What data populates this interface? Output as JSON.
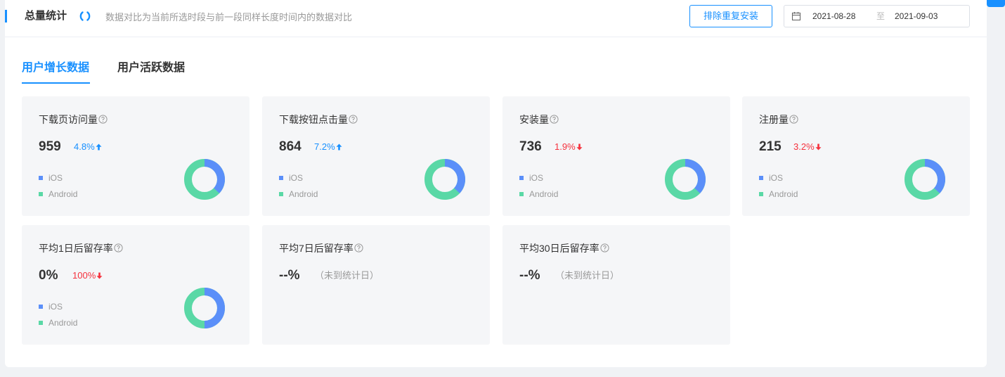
{
  "header": {
    "title": "总量统计",
    "subtitle": "数据对比为当前所选时段与前一段同样长度时间内的数据对比",
    "dedupe_button": "排除重复安装",
    "date_start": "2021-08-28",
    "date_separator": "至",
    "date_end": "2021-09-03"
  },
  "tabs": [
    {
      "label": "用户增长数据",
      "active": true
    },
    {
      "label": "用户活跃数据",
      "active": false
    }
  ],
  "legend": {
    "ios": "iOS",
    "android": "Android"
  },
  "colors": {
    "accent": "#1890ff",
    "ios": "#5b8ff9",
    "android": "#5ad8a6",
    "down": "#f5313d"
  },
  "cards": [
    {
      "title": "下载页访问量",
      "value": "959",
      "change": "4.8%",
      "trend": "up",
      "ios_share": 0.37
    },
    {
      "title": "下载按钮点击量",
      "value": "864",
      "change": "7.2%",
      "trend": "up",
      "ios_share": 0.37
    },
    {
      "title": "安装量",
      "value": "736",
      "change": "1.9%",
      "trend": "down",
      "ios_share": 0.37
    },
    {
      "title": "注册量",
      "value": "215",
      "change": "3.2%",
      "trend": "down",
      "ios_share": 0.37
    },
    {
      "title": "平均1日后留存率",
      "value": "0%",
      "change": "100%",
      "trend": "down",
      "ios_share": 0.5
    },
    {
      "title": "平均7日后留存率",
      "value": "--%",
      "note": "（未到统计日）"
    },
    {
      "title": "平均30日后留存率",
      "value": "--%",
      "note": "（未到统计日）"
    }
  ]
}
